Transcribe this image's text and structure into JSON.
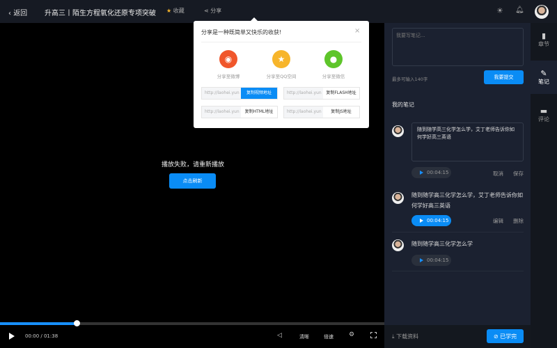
{
  "header": {
    "back_label": "返回",
    "title": "升高三丨陌生方程氧化还原专项突破",
    "favorite_label": "收藏",
    "share_label": "分享"
  },
  "share_popup": {
    "title": "分享是一种既简单又快乐的收获!",
    "targets": [
      {
        "label": "分享至微博",
        "color": "#f0562b",
        "icon": "weibo-icon"
      },
      {
        "label": "分享至QQ空间",
        "color": "#f7b52b",
        "icon": "qzone-icon"
      },
      {
        "label": "分享至微信",
        "color": "#5ec52a",
        "icon": "wechat-icon"
      }
    ],
    "links": [
      {
        "url": "http://laohei.yun",
        "button": "复制视频地址"
      },
      {
        "url": "http://laohei.yun",
        "button": "复制FLASH地址"
      },
      {
        "url": "http://laohei.yun",
        "button": "复制HTML地址"
      },
      {
        "url": "http://laohei.yun",
        "button": "复制JS地址"
      }
    ]
  },
  "player": {
    "error_message": "播放失败，请重新播放",
    "retry_label": "点击刷新",
    "time": "00:00 / 01:38",
    "progress_percent": 20,
    "quality_label": "清晰",
    "speed_label": "倍速"
  },
  "notes": {
    "placeholder": "我要写笔记...",
    "limit_hint": "最多可输入140字",
    "submit_label": "我要提交",
    "section_title": "我的笔记",
    "items": [
      {
        "text": "随到随学高三化学怎么学，艾丁老师告诉你如何学好高三英语",
        "time": "00:04:15",
        "actions": [
          "取消",
          "保存"
        ],
        "editing": true
      },
      {
        "text": "随到随学高三化学怎么学，艾丁老师告诉你如何学好高三英语",
        "time": "00:04:15",
        "actions": [
          "编辑",
          "删除"
        ],
        "editing": false
      },
      {
        "text": "随到随学高三化学怎么学",
        "time": "00:04:15",
        "actions": [],
        "editing": false
      }
    ],
    "download_label": "下载资料",
    "done_label": "已学完"
  },
  "sidebar": {
    "items": [
      {
        "label": "章节"
      },
      {
        "label": "笔记",
        "active": true
      },
      {
        "label": "评论"
      }
    ]
  },
  "colors": {
    "accent": "#0a8cf5",
    "favorite": "#f7b52b"
  }
}
